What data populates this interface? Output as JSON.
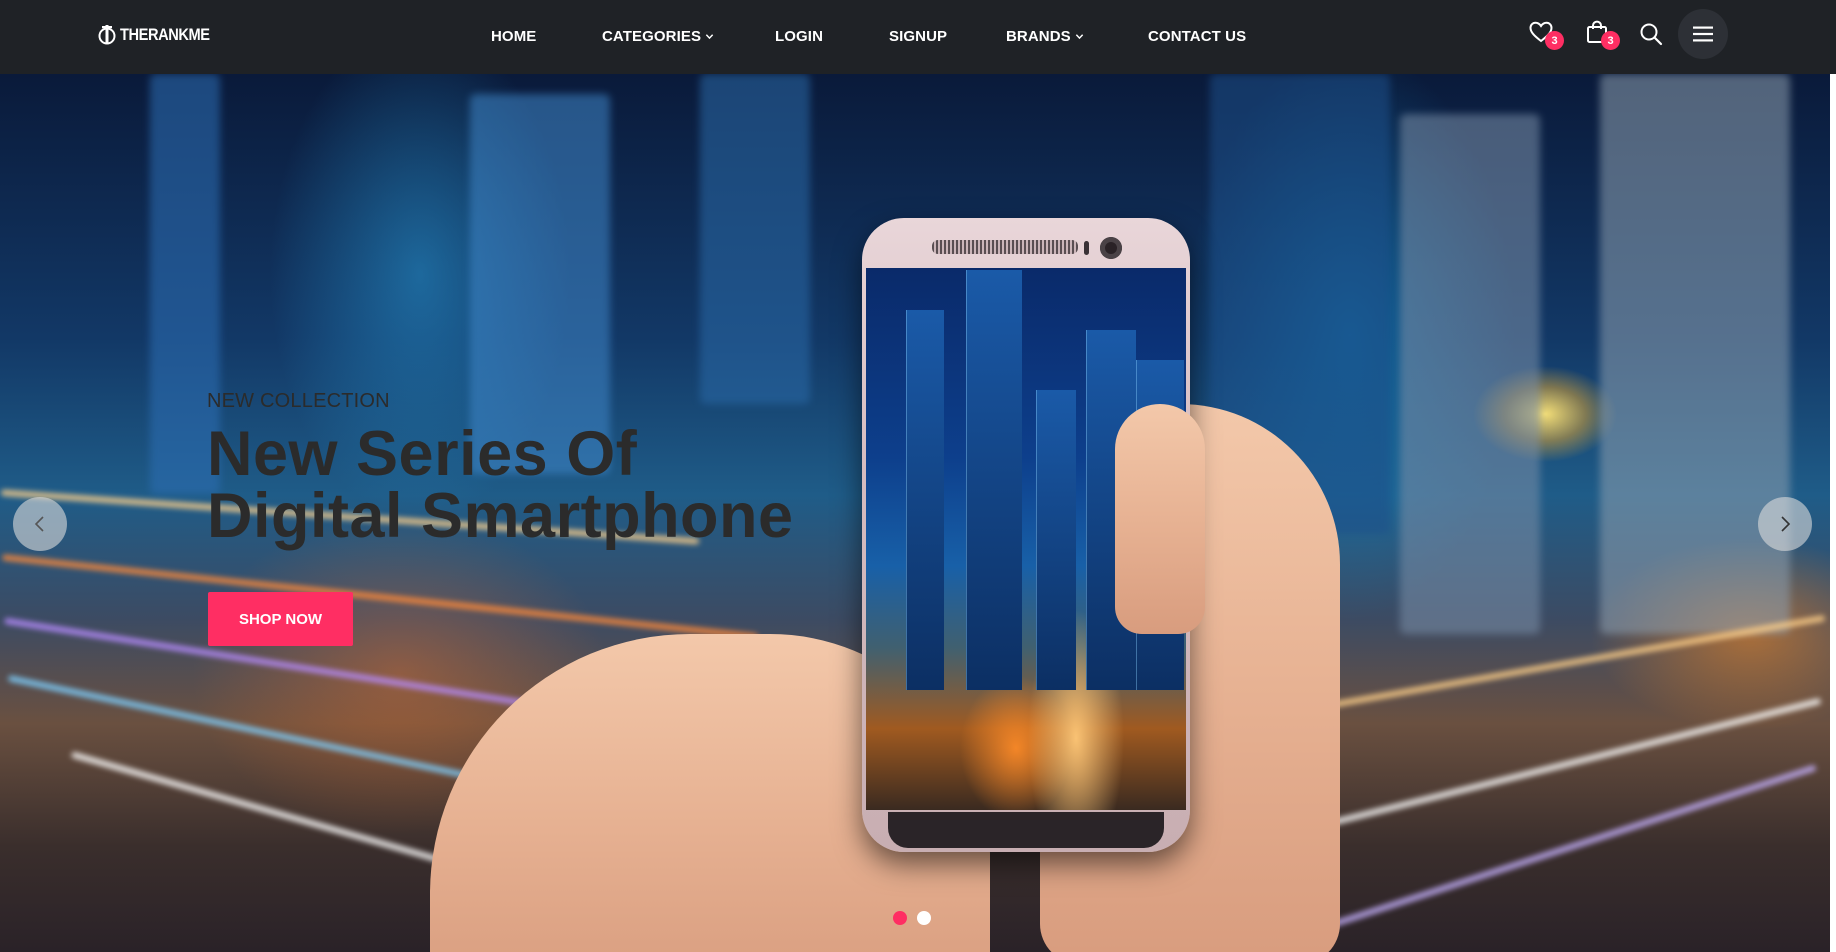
{
  "brand": {
    "logo_text": "THERANKME"
  },
  "nav": {
    "items": [
      {
        "label": "HOME"
      },
      {
        "label": "CATEGORIES",
        "has_dropdown": true
      },
      {
        "label": "LOGIN"
      },
      {
        "label": "SIGNUP"
      },
      {
        "label": "BRANDS",
        "has_dropdown": true
      },
      {
        "label": "CONTACT US"
      }
    ]
  },
  "header_icons": {
    "wishlist": {
      "icon": "heart-icon",
      "count": "3"
    },
    "cart": {
      "icon": "shopping-bag-icon",
      "count": "3"
    },
    "search": {
      "icon": "search-icon"
    },
    "menu": {
      "icon": "hamburger-menu-icon"
    }
  },
  "hero": {
    "kicker": "NEW COLLECTION",
    "headline_line1": "New Series Of",
    "headline_line2": "Digital Smartphone",
    "cta_label": "SHOP NOW",
    "slides_total": 2,
    "active_slide": 1
  },
  "colors": {
    "header_bg": "#1f2226",
    "accent": "#ff2e63",
    "headline": "#2b2b2b",
    "dot_active": "#ff2e63",
    "dot_inactive": "#ffffff"
  }
}
